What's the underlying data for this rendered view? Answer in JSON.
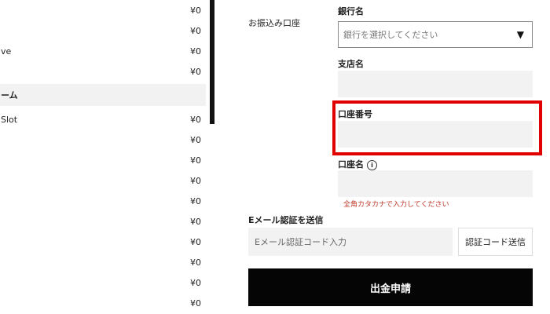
{
  "left_list": {
    "rows_top": [
      {
        "label": "",
        "value": "¥0"
      },
      {
        "label": "",
        "value": "¥0"
      },
      {
        "label": "ve",
        "value": "¥0"
      },
      {
        "label": "",
        "value": "¥0"
      }
    ],
    "section_title": "ーム",
    "rows_bottom": [
      {
        "label": "Slot",
        "value": "¥0"
      },
      {
        "label": "",
        "value": "¥0"
      },
      {
        "label": "",
        "value": "¥0"
      },
      {
        "label": "",
        "value": "¥0"
      },
      {
        "label": "",
        "value": "¥0"
      },
      {
        "label": "",
        "value": "¥0"
      },
      {
        "label": "",
        "value": "¥0"
      },
      {
        "label": "",
        "value": "¥0"
      },
      {
        "label": "",
        "value": "¥0"
      },
      {
        "label": "",
        "value": "¥0"
      }
    ]
  },
  "form": {
    "transfer_account_label": "お振込み口座",
    "bank_name": {
      "label": "銀行名",
      "placeholder": "銀行を選択してください",
      "caret": "▼"
    },
    "branch_name": {
      "label": "支店名",
      "value": ""
    },
    "account_number": {
      "label": "口座番号",
      "value": ""
    },
    "account_holder": {
      "label": "口座名",
      "info_glyph": "i",
      "value": "",
      "hint": "全角カタカナで入力してください"
    },
    "email_verify": {
      "label": "Eメール認証を送信",
      "placeholder": "Eメール認証コード入力",
      "send_button": "認証コード送信"
    },
    "submit_button": "出金申請"
  },
  "colors": {
    "highlight": "#e00000",
    "hint_text": "#c0392b",
    "submit_bg": "#050505",
    "input_bg": "#f2f2f2"
  }
}
